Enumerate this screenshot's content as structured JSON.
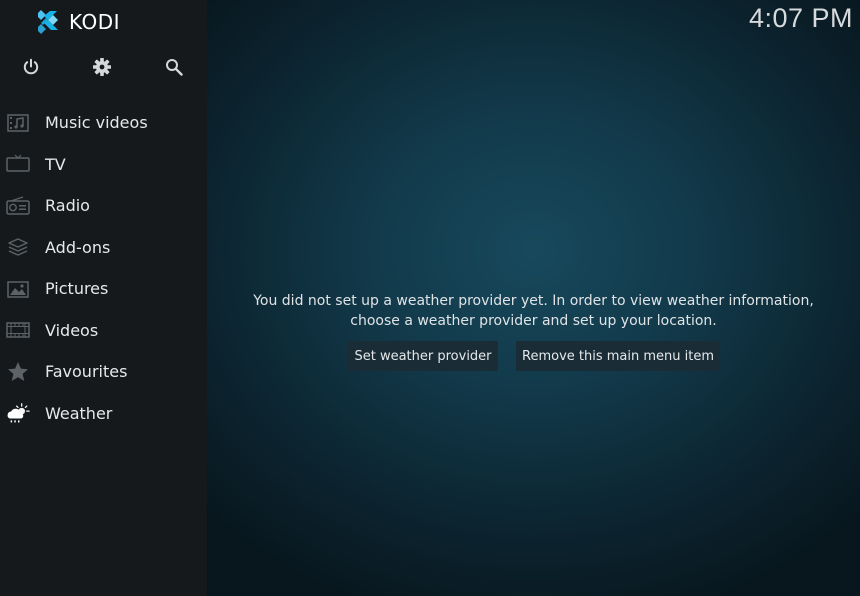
{
  "app": {
    "name": "KODI",
    "clock": "4:07 PM"
  },
  "sidebar": {
    "top_icons": [
      {
        "icon": "power-icon"
      },
      {
        "icon": "gear-icon"
      },
      {
        "icon": "search-icon"
      }
    ],
    "items": [
      {
        "label": "Music videos",
        "icon": "music-video-icon"
      },
      {
        "label": "TV",
        "icon": "tv-icon"
      },
      {
        "label": "Radio",
        "icon": "radio-icon"
      },
      {
        "label": "Add-ons",
        "icon": "addons-icon"
      },
      {
        "label": "Pictures",
        "icon": "pictures-icon"
      },
      {
        "label": "Videos",
        "icon": "film-icon"
      },
      {
        "label": "Favourites",
        "icon": "star-icon"
      },
      {
        "label": "Weather",
        "icon": "weather-icon"
      }
    ]
  },
  "main": {
    "message_line1": "You did not set up a weather provider yet. In order to view weather information,",
    "message_line2": "choose a weather provider and set up your location.",
    "buttons": {
      "set_provider": "Set weather provider",
      "remove_item": "Remove this main menu item"
    }
  },
  "colors": {
    "sidebar_bg": "#16191c",
    "main_bg": "#123a4b",
    "button_bg": "#1a2d37",
    "logo_accent": "#17b2e8"
  }
}
